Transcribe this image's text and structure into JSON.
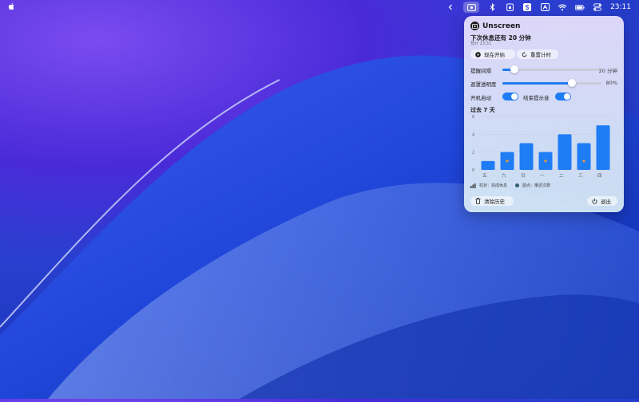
{
  "menubar": {
    "clock": "23:11",
    "icons": [
      "apple-icon",
      "chevron-left-icon",
      "unscreen-icon",
      "bluetooth-icon",
      "calendar-icon",
      "s-app-icon",
      "a-app-icon",
      "wifi-icon",
      "battery-icon",
      "control-center-icon"
    ]
  },
  "popover": {
    "app_name": "Unscreen",
    "next_break": "下次休息还有 20 分钟",
    "eta": "预计 23:31",
    "start_now": "现在开始",
    "reset_timer": "重置计时",
    "interval": {
      "label": "提醒间隔",
      "value": "20 分钟",
      "fraction": 0.12
    },
    "opacity": {
      "label": "遮罩透明度",
      "value": "80%",
      "fraction": 0.7
    },
    "launch_at_login": {
      "label": "开机启动",
      "on": true
    },
    "end_sound": {
      "label": "结束提示音",
      "on": true
    },
    "history_title": "过去 7 天",
    "legend": {
      "bars": "柱状：完成休息",
      "dots": "圆点：推迟次数"
    },
    "clear_history": "清除历史",
    "quit": "退出"
  },
  "chart_data": {
    "type": "bar",
    "categories": [
      "五",
      "六",
      "日",
      "一",
      "二",
      "三",
      "四"
    ],
    "series": [
      {
        "name": "柱状：完成休息",
        "values": [
          1,
          2,
          3,
          2,
          4,
          3,
          5
        ]
      },
      {
        "name": "圆点：推迟次数",
        "values": [
          0,
          1,
          0,
          1,
          0,
          1,
          0
        ]
      }
    ],
    "ylim": [
      0,
      6
    ],
    "yticks": [
      "0",
      "2",
      "4",
      "6"
    ],
    "grid": true,
    "colors": {
      "bar": "#1e7cf5",
      "dot": "#e89a3c"
    }
  }
}
